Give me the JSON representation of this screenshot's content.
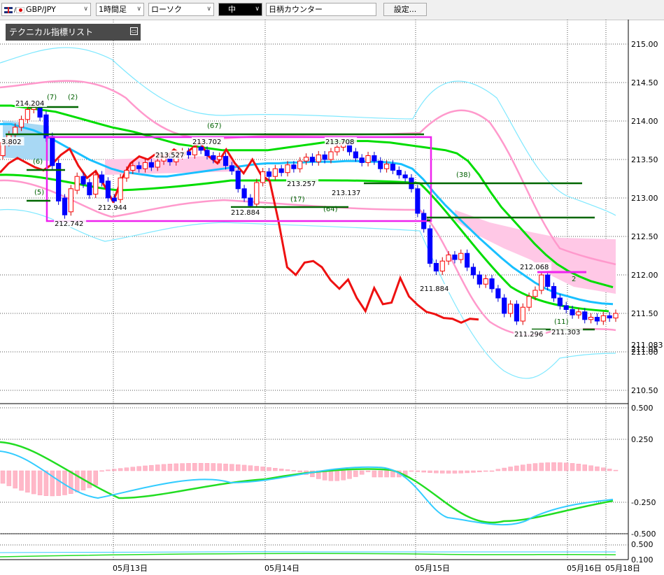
{
  "toolbar": {
    "symbol": "GBP/JPY",
    "timeframe": "1時間足",
    "chart_style": "ローソク",
    "toggle": "中",
    "counter": "日柄カウンター",
    "settings": "設定..."
  },
  "indicator_panel": {
    "title": "テクニカル指標リスト"
  },
  "colors": {
    "candle_up": "#ff0000",
    "candle_down": "#0000ff",
    "ma_green": "#00dd00",
    "ma_cyan": "#19c0ff",
    "bb_pink": "#ff99cc",
    "bb_cyan": "#7ee8ff",
    "chikou": "#ee1111",
    "cloud": "#ffc8e6",
    "box": "#ee22ee",
    "level": "#006600"
  },
  "chart_data": [
    {
      "type": "candlestick",
      "title": "GBP/JPY 1時間足",
      "ylim": [
        210.4,
        215.4
      ],
      "y_ticks": [
        "215.00",
        "214.50",
        "214.00",
        "213.50",
        "213.00",
        "212.50",
        "212.00",
        "211.50",
        "211.00",
        "210.50"
      ],
      "current_price_labels": [
        "211.083",
        "211.05"
      ],
      "x_labels": [
        "05月13日",
        "05月14日",
        "05月15日",
        "05月16日",
        "05月18日"
      ],
      "candles": [
        {
          "o": 213.55,
          "c": 213.72
        },
        {
          "o": 213.72,
          "c": 213.82
        },
        {
          "o": 213.82,
          "c": 213.92
        },
        {
          "o": 213.92,
          "c": 214.02
        },
        {
          "o": 214.02,
          "c": 214.15
        },
        {
          "o": 214.15,
          "c": 214.2
        },
        {
          "o": 214.17,
          "c": 214.05
        },
        {
          "o": 214.08,
          "c": 213.78
        },
        {
          "o": 213.8,
          "c": 213.42
        },
        {
          "o": 213.45,
          "c": 212.96
        },
        {
          "o": 213.0,
          "c": 212.78
        },
        {
          "o": 212.82,
          "c": 213.12
        },
        {
          "o": 213.1,
          "c": 213.28
        },
        {
          "o": 213.28,
          "c": 213.18
        },
        {
          "o": 213.2,
          "c": 213.04
        },
        {
          "o": 213.05,
          "c": 213.3
        },
        {
          "o": 213.3,
          "c": 213.2
        },
        {
          "o": 213.22,
          "c": 213.0
        },
        {
          "o": 213.0,
          "c": 212.96
        },
        {
          "o": 212.98,
          "c": 213.26
        },
        {
          "o": 213.26,
          "c": 213.36
        },
        {
          "o": 213.36,
          "c": 213.42
        },
        {
          "o": 213.42,
          "c": 213.38
        },
        {
          "o": 213.38,
          "c": 213.46
        },
        {
          "o": 213.46,
          "c": 213.4
        },
        {
          "o": 213.4,
          "c": 213.48
        },
        {
          "o": 213.48,
          "c": 213.52
        },
        {
          "o": 213.52,
          "c": 213.47
        },
        {
          "o": 213.47,
          "c": 213.55
        },
        {
          "o": 213.55,
          "c": 213.6
        },
        {
          "o": 213.6,
          "c": 213.56
        },
        {
          "o": 213.56,
          "c": 213.66
        },
        {
          "o": 213.66,
          "c": 213.62
        },
        {
          "o": 213.62,
          "c": 213.55
        },
        {
          "o": 213.55,
          "c": 213.5
        },
        {
          "o": 213.5,
          "c": 213.54
        },
        {
          "o": 213.54,
          "c": 213.42
        },
        {
          "o": 213.42,
          "c": 213.35
        },
        {
          "o": 213.35,
          "c": 213.12
        },
        {
          "o": 213.12,
          "c": 213.0
        },
        {
          "o": 213.0,
          "c": 212.9
        },
        {
          "o": 212.92,
          "c": 213.2
        },
        {
          "o": 213.2,
          "c": 213.34
        },
        {
          "o": 213.34,
          "c": 213.28
        },
        {
          "o": 213.28,
          "c": 213.38
        },
        {
          "o": 213.38,
          "c": 213.33
        },
        {
          "o": 213.33,
          "c": 213.43
        },
        {
          "o": 213.43,
          "c": 213.38
        },
        {
          "o": 213.38,
          "c": 213.48
        },
        {
          "o": 213.48,
          "c": 213.53
        },
        {
          "o": 213.53,
          "c": 213.47
        },
        {
          "o": 213.47,
          "c": 213.56
        },
        {
          "o": 213.56,
          "c": 213.5
        },
        {
          "o": 213.5,
          "c": 213.6
        },
        {
          "o": 213.6,
          "c": 213.66
        },
        {
          "o": 213.66,
          "c": 213.72
        },
        {
          "o": 213.72,
          "c": 213.6
        },
        {
          "o": 213.6,
          "c": 213.52
        },
        {
          "o": 213.52,
          "c": 213.46
        },
        {
          "o": 213.46,
          "c": 213.55
        },
        {
          "o": 213.55,
          "c": 213.48
        },
        {
          "o": 213.48,
          "c": 213.38
        },
        {
          "o": 213.38,
          "c": 213.44
        },
        {
          "o": 213.44,
          "c": 213.36
        },
        {
          "o": 213.36,
          "c": 213.3
        },
        {
          "o": 213.3,
          "c": 213.26
        },
        {
          "o": 213.26,
          "c": 213.12
        },
        {
          "o": 213.12,
          "c": 212.8
        },
        {
          "o": 212.8,
          "c": 212.6
        },
        {
          "o": 212.6,
          "c": 212.15
        },
        {
          "o": 212.15,
          "c": 212.05
        },
        {
          "o": 212.05,
          "c": 212.18
        },
        {
          "o": 212.18,
          "c": 212.26
        },
        {
          "o": 212.26,
          "c": 212.2
        },
        {
          "o": 212.2,
          "c": 212.28
        },
        {
          "o": 212.28,
          "c": 212.1
        },
        {
          "o": 212.1,
          "c": 212.0
        },
        {
          "o": 212.0,
          "c": 211.88
        },
        {
          "o": 211.88,
          "c": 211.95
        },
        {
          "o": 211.95,
          "c": 211.82
        },
        {
          "o": 211.82,
          "c": 211.7
        },
        {
          "o": 211.7,
          "c": 211.5
        },
        {
          "o": 211.5,
          "c": 211.62
        },
        {
          "o": 211.62,
          "c": 211.4
        },
        {
          "o": 211.4,
          "c": 211.58
        },
        {
          "o": 211.58,
          "c": 211.72
        },
        {
          "o": 211.72,
          "c": 211.8
        },
        {
          "o": 211.8,
          "c": 212.0
        },
        {
          "o": 212.0,
          "c": 211.85
        },
        {
          "o": 211.85,
          "c": 211.7
        },
        {
          "o": 211.7,
          "c": 211.6
        },
        {
          "o": 211.6,
          "c": 211.55
        },
        {
          "o": 211.55,
          "c": 211.48
        },
        {
          "o": 211.48,
          "c": 211.52
        },
        {
          "o": 211.52,
          "c": 211.42
        },
        {
          "o": 211.42,
          "c": 211.45
        },
        {
          "o": 211.45,
          "c": 211.4
        },
        {
          "o": 211.4,
          "c": 211.47
        },
        {
          "o": 211.47,
          "c": 211.44
        },
        {
          "o": 211.44,
          "c": 211.5
        }
      ],
      "series": [
        {
          "name": "chikou",
          "values": [
            213.33,
            213.45,
            213.52,
            213.46,
            213.4,
            213.36,
            213.44,
            213.56,
            213.64,
            213.42,
            213.26,
            213.35,
            213.16,
            212.95,
            213.25,
            213.45,
            213.54,
            213.5,
            213.58,
            213.52,
            213.63,
            213.55,
            213.64,
            213.72,
            213.54,
            213.45,
            213.63,
            213.45,
            213.32,
            213.5,
            213.3,
            213.22,
            212.7,
            212.1,
            212.0,
            212.16,
            212.18,
            212.1,
            211.93,
            211.82,
            211.94,
            211.7,
            211.53,
            211.83,
            211.62,
            211.64,
            211.96,
            211.72,
            211.61,
            211.52,
            211.49,
            211.44,
            211.43,
            211.38,
            211.43,
            211.42
          ]
        },
        {
          "name": "ma_green",
          "values": [
            214.2,
            214.2,
            214.18,
            214.16,
            214.14,
            214.12,
            214.08,
            214.04,
            214.0,
            213.96,
            213.92,
            213.89,
            213.86,
            213.82,
            213.78,
            213.74,
            213.7,
            213.68,
            213.66,
            213.64,
            213.62,
            213.62,
            213.62,
            213.62,
            213.62,
            213.64,
            213.66,
            213.68,
            213.7,
            213.72,
            213.73,
            213.74,
            213.74,
            213.74,
            213.73,
            213.72,
            213.7,
            213.68,
            213.66,
            213.64,
            213.62,
            213.58,
            213.48,
            213.3,
            213.08,
            212.88,
            212.72,
            212.56,
            212.4,
            212.26,
            212.14,
            212.05,
            211.98,
            211.92,
            211.88,
            211.84
          ]
        },
        {
          "name": "ma_cyan",
          "values": [
            213.96,
            213.96,
            213.92,
            213.88,
            213.82,
            213.74,
            213.66,
            213.58,
            213.5,
            213.44,
            213.38,
            213.34,
            213.32,
            213.3,
            213.28,
            213.28,
            213.3,
            213.32,
            213.34,
            213.36,
            213.38,
            213.4,
            213.42,
            213.44,
            213.45,
            213.45,
            213.46,
            213.46,
            213.47,
            213.47,
            213.47,
            213.48,
            213.48,
            213.47,
            213.47,
            213.46,
            213.44,
            213.38,
            213.24,
            213.06,
            212.9,
            212.76,
            212.62,
            212.48,
            212.35,
            212.22,
            212.1,
            212.0,
            211.9,
            211.82,
            211.76,
            211.72,
            211.68,
            211.65,
            211.63,
            211.62
          ]
        }
      ],
      "levels": [
        213.87,
        213.2,
        212.78,
        212.9,
        211.5
      ],
      "annotations": [
        {
          "text": "214.204",
          "x": 5,
          "price": 214.204
        },
        {
          "text": "213.527",
          "x": 23,
          "price": 213.527
        },
        {
          "text": "213.702",
          "x": 30,
          "price": 213.702
        },
        {
          "text": "213.708",
          "x": 55,
          "price": 213.708
        },
        {
          "text": "213.257",
          "x": 44,
          "price": 213.257
        },
        {
          "text": "213.137",
          "x": 55,
          "price": 213.137
        },
        {
          "text": "212.944",
          "x": 17,
          "price": 212.944
        },
        {
          "text": "212.884",
          "x": 40,
          "price": 212.884
        },
        {
          "text": "212.742",
          "x": 11,
          "price": 212.742
        },
        {
          "text": "211.884",
          "x": 76,
          "price": 211.884
        },
        {
          "text": "212.068",
          "x": 86,
          "price": 212.068
        },
        {
          "text": "211.296",
          "x": 85,
          "price": 211.296
        },
        {
          "text": "211.303",
          "x": 94,
          "price": 211.303
        },
        {
          "text": "3.802",
          "x": 0,
          "price": 213.802
        }
      ],
      "counts": [
        "(7)",
        "(2)",
        "(67)",
        "(6)",
        "(5)",
        "(38)",
        "(17)",
        "(64)",
        "(11)",
        "2"
      ]
    },
    {
      "type": "macd",
      "y_ticks": [
        "0.500",
        "0.250",
        "-0.250",
        "-0.500"
      ],
      "ylim": [
        -0.55,
        0.55
      ]
    },
    {
      "type": "oscillator",
      "y_ticks": [
        "0.500",
        "0.100"
      ]
    }
  ]
}
